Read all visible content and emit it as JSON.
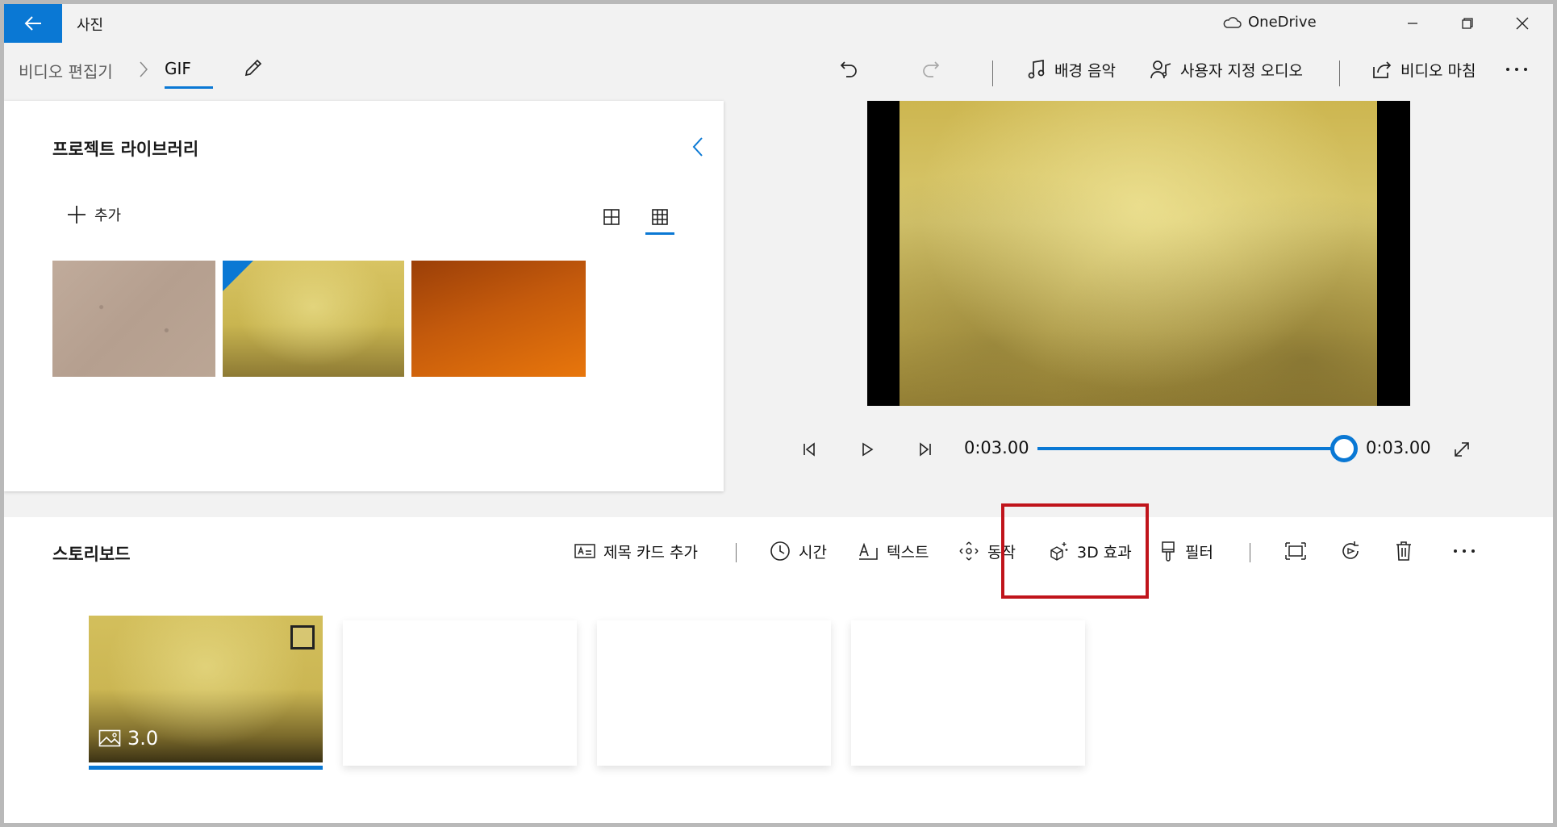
{
  "app": {
    "title": "사진",
    "onedrive_label": "OneDrive"
  },
  "breadcrumb": {
    "parent": "비디오 편집기",
    "current": "GIF"
  },
  "toolbar": {
    "background_music": "배경 음악",
    "custom_audio": "사용자 지정 오디오",
    "finish_video": "비디오 마침"
  },
  "library": {
    "title": "프로젝트 라이브러리",
    "add_label": "추가",
    "items": [
      {
        "name": "cardboard texture"
      },
      {
        "name": "gold texture",
        "selected": true
      },
      {
        "name": "orange texture"
      }
    ]
  },
  "player": {
    "current_time": "0:03.00",
    "total_time": "0:03.00",
    "progress": 1.0
  },
  "storyboard": {
    "title": "스토리보드",
    "add_title_card": "제목 카드 추가",
    "duration": "시간",
    "text": "텍스트",
    "motion": "동작",
    "effects_3d": "3D 효과",
    "filters": "필터",
    "clips": [
      {
        "duration": "3.0",
        "type": "image"
      }
    ]
  },
  "colors": {
    "accent": "#0a78d4",
    "highlight": "#c0141b"
  }
}
